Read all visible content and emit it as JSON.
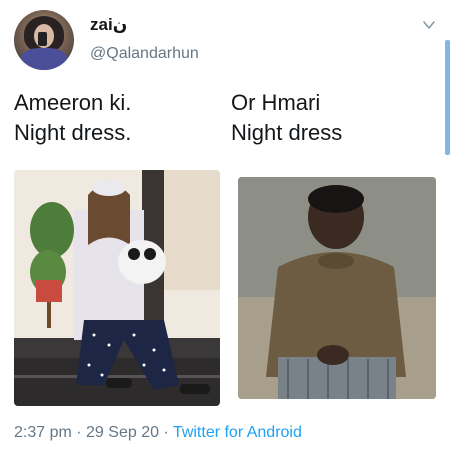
{
  "user": {
    "display_name": "zaiن",
    "handle": "@Qalandarhun",
    "avatar_icon": "avatar-photo"
  },
  "menu": {
    "icon": "chevron-down-icon"
  },
  "captions": {
    "left": [
      "Ameeron ki.",
      "Night dress."
    ],
    "right": [
      "Or Hmari",
      "Night dress"
    ]
  },
  "images": {
    "left": "girl-in-polka-dot-pajamas-with-panda",
    "right": "boy-sitting-sulking"
  },
  "footer": {
    "time": "2:37 pm",
    "separator1": " · ",
    "date": "29 Sep 20",
    "separator2": " · ",
    "source": "Twitter for Android"
  },
  "colors": {
    "link": "#1da1f2",
    "secondary_text": "#657786",
    "primary_text": "#14171a"
  }
}
